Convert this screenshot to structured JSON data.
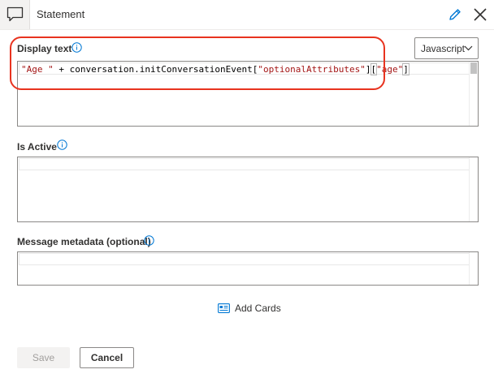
{
  "header": {
    "title": "Statement",
    "icons": {
      "panel": "comment-icon",
      "edit": "pencil-icon",
      "close": "close-icon"
    }
  },
  "display_text": {
    "label": "Display text",
    "language": "Javascript",
    "code_tokens": [
      {
        "type": "str",
        "text": "\"Age \""
      },
      {
        "type": "plain",
        "text": " + conversation.initConversationEvent["
      },
      {
        "type": "str",
        "text": "\"optionalAttributes\""
      },
      {
        "type": "plain",
        "text": "]"
      },
      {
        "type": "br",
        "text": "["
      },
      {
        "type": "str",
        "text": "\"age\""
      },
      {
        "type": "br",
        "text": "]"
      }
    ]
  },
  "is_active": {
    "label": "Is Active"
  },
  "message_metadata": {
    "label": "Message metadata (optional)"
  },
  "add_cards": {
    "label": "Add Cards"
  },
  "footer": {
    "save_label": "Save",
    "cancel_label": "Cancel"
  },
  "colors": {
    "highlight": "#e8331f",
    "info": "#0078d4",
    "string_literal": "#a31515"
  }
}
